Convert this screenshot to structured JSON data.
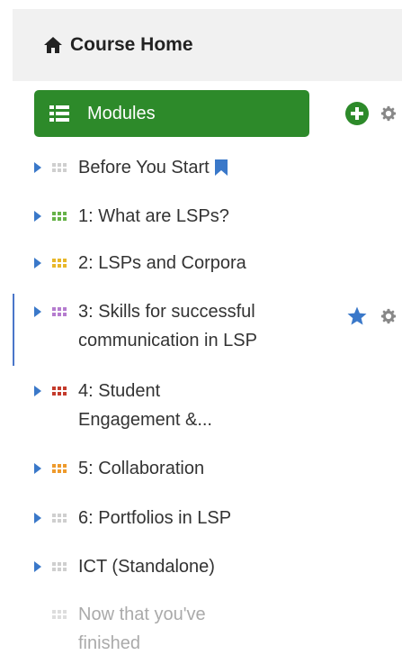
{
  "header": {
    "title": "Course Home"
  },
  "modules_button": {
    "label": "Modules"
  },
  "colors": {
    "accent_green": "#2d8a2a",
    "link_blue": "#3a78c9",
    "gear_gray": "#888888",
    "grid_gray": "#cfcfcf",
    "grid_green": "#66b248",
    "grid_yellow": "#e8b72a",
    "grid_purple": "#b57ccf",
    "grid_red": "#c43b2c",
    "grid_orange": "#ee9a2c"
  },
  "items": [
    {
      "label": "Before You Start",
      "icon": "bookmark-icon",
      "grid_color": "gray"
    },
    {
      "label": "1: What are LSPs?",
      "grid_color": "green"
    },
    {
      "label": "2: LSPs and Corpora",
      "grid_color": "yellow"
    },
    {
      "label": "3: Skills for successful communication in LSP",
      "grid_color": "purple",
      "line1": "3: Skills for successful",
      "line2": "communication in LSP"
    },
    {
      "label": "4: Student Engagement &...",
      "grid_color": "red",
      "line1": "4: Student",
      "line2": "Engagement &..."
    },
    {
      "label": "5: Collaboration",
      "grid_color": "orange"
    },
    {
      "label": "6: Portfolios in LSP",
      "grid_color": "gray"
    },
    {
      "label": "ICT (Standalone)",
      "grid_color": "gray"
    },
    {
      "label": "Now that you've finished",
      "grid_color": "gray",
      "line1": "Now that you've",
      "line2": "finished"
    }
  ]
}
